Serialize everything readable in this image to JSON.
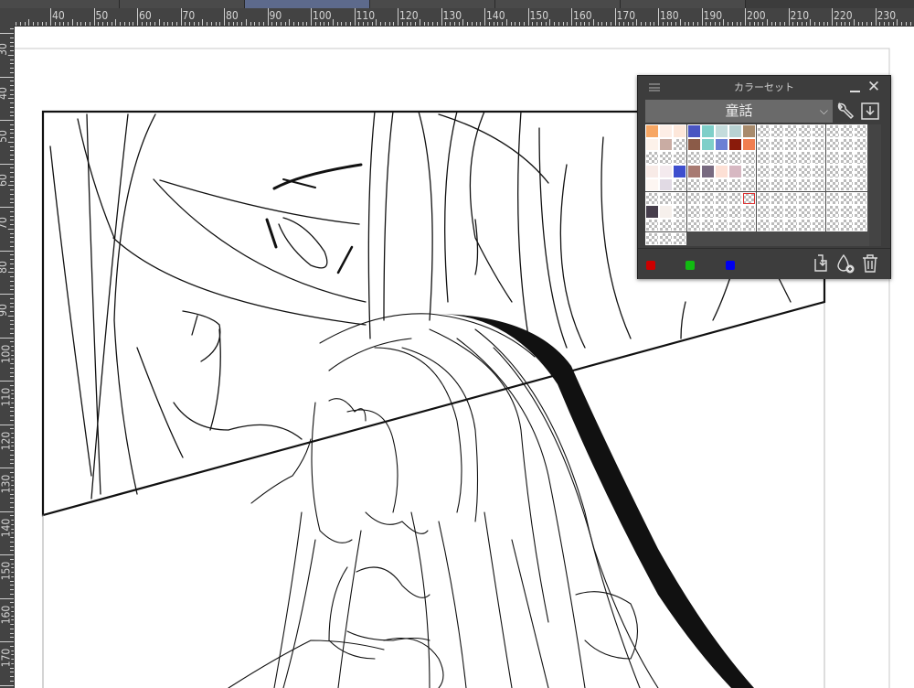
{
  "app": "Clip Studio Paint",
  "rulers": {
    "horizontal_labels": [
      "40",
      "50",
      "60",
      "70",
      "80",
      "90",
      "100",
      "110",
      "120",
      "130",
      "140",
      "150",
      "160",
      "170",
      "180",
      "190",
      "200",
      "210",
      "220",
      "230"
    ],
    "vertical_labels": [
      "30",
      "40",
      "50",
      "60",
      "70",
      "80",
      "90",
      "100",
      "110",
      "120",
      "130",
      "140",
      "150",
      "160",
      "170"
    ]
  },
  "color_set_panel": {
    "title": "カラーセット",
    "set_name": "童話",
    "close_glyph": "✕",
    "dropdown_glyph": "⌵",
    "icons": [
      "menu-icon",
      "minimize-icon",
      "close-icon",
      "wrench-icon",
      "import-icon",
      "replace-color-icon",
      "add-color-icon",
      "trash-icon"
    ],
    "swatch_rows": [
      [
        "#f7a764",
        "#fdeee6",
        "#fde7da",
        "#4a55c2",
        "#7ecfc9",
        "#c4dcdc",
        "#b8d2d2",
        "#a88b6c",
        null,
        null,
        null,
        null,
        null,
        null,
        null,
        null
      ],
      [
        "#fdf2ea",
        "#c9aca3",
        null,
        "#8b5b48",
        "#7ecfc9",
        "#6c80d4",
        "#8a1b0b",
        "#f07e50",
        null,
        null,
        null,
        null,
        null,
        null,
        null,
        null
      ],
      [
        null,
        null,
        null,
        null,
        null,
        null,
        null,
        null,
        null,
        null,
        null,
        null,
        null,
        null,
        null,
        null
      ],
      [
        "#f8ebe7",
        "#f4eaee",
        "#3e4ece",
        "#a87a72",
        "#786a80",
        "#fde0d5",
        "#d7b8c2",
        null,
        null,
        null,
        null,
        null,
        null,
        null,
        null,
        null
      ],
      [
        "#fdf6f2",
        "#e1dae4",
        null,
        null,
        null,
        null,
        null,
        null,
        null,
        null,
        null,
        null,
        null,
        null,
        null,
        null
      ],
      [
        null,
        null,
        null,
        null,
        null,
        null,
        null,
        null,
        null,
        null,
        null,
        null,
        null,
        null,
        null,
        null
      ],
      [
        "#463e4c",
        "#f6f0ec",
        null,
        null,
        null,
        null,
        null,
        null,
        null,
        null,
        null,
        null,
        null,
        null,
        null,
        null
      ],
      [
        null,
        null,
        null,
        null,
        null,
        null,
        null,
        null,
        null,
        null,
        null,
        null,
        null,
        null,
        null,
        null
      ],
      [
        null,
        null,
        null
      ]
    ],
    "selected_swatch": {
      "row": 5,
      "col": 7
    },
    "bottom_colors": [
      "#cc0000",
      "#11bb11",
      "#0000ee"
    ]
  }
}
